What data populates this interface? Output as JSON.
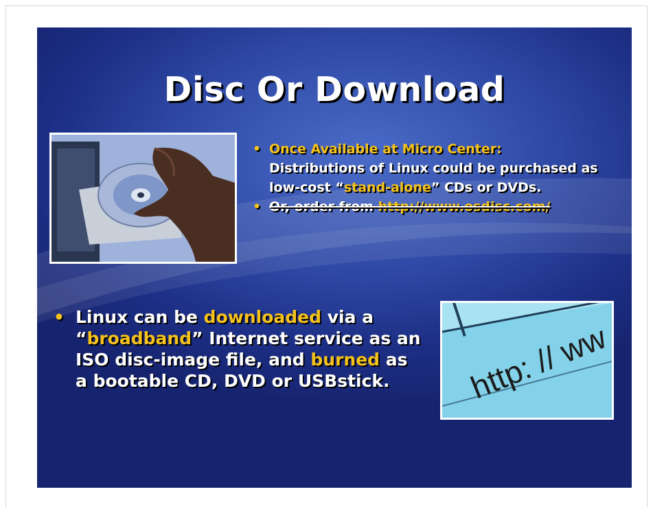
{
  "slide": {
    "title": "Disc Or Download",
    "bullet_1": {
      "prefix": "Once Available at Micro Center:",
      "line": "Distributions of Linux could be purchased as low-cost “",
      "highlight": "stand-alone",
      "suffix": "” CDs or DVDs."
    },
    "bullet_2": {
      "text": "Or, order from ",
      "link": "http://www.osdisc.com/"
    },
    "bullet_3": {
      "t1": "Linux can be ",
      "h1": "downloaded",
      "t2": " via a “",
      "h2": "broadband",
      "t3": "” Internet service as an ISO disc-image file, and ",
      "h3": "burned",
      "t4": " as a bootable CD, DVD or USBstick."
    },
    "http_photo_text": "http: // ww"
  },
  "colors": {
    "highlight": "#f5c21b",
    "slide_bg_dark": "#16236e",
    "slide_bg_light": "#4a6cc8"
  },
  "icons": {
    "bullet": "•"
  }
}
